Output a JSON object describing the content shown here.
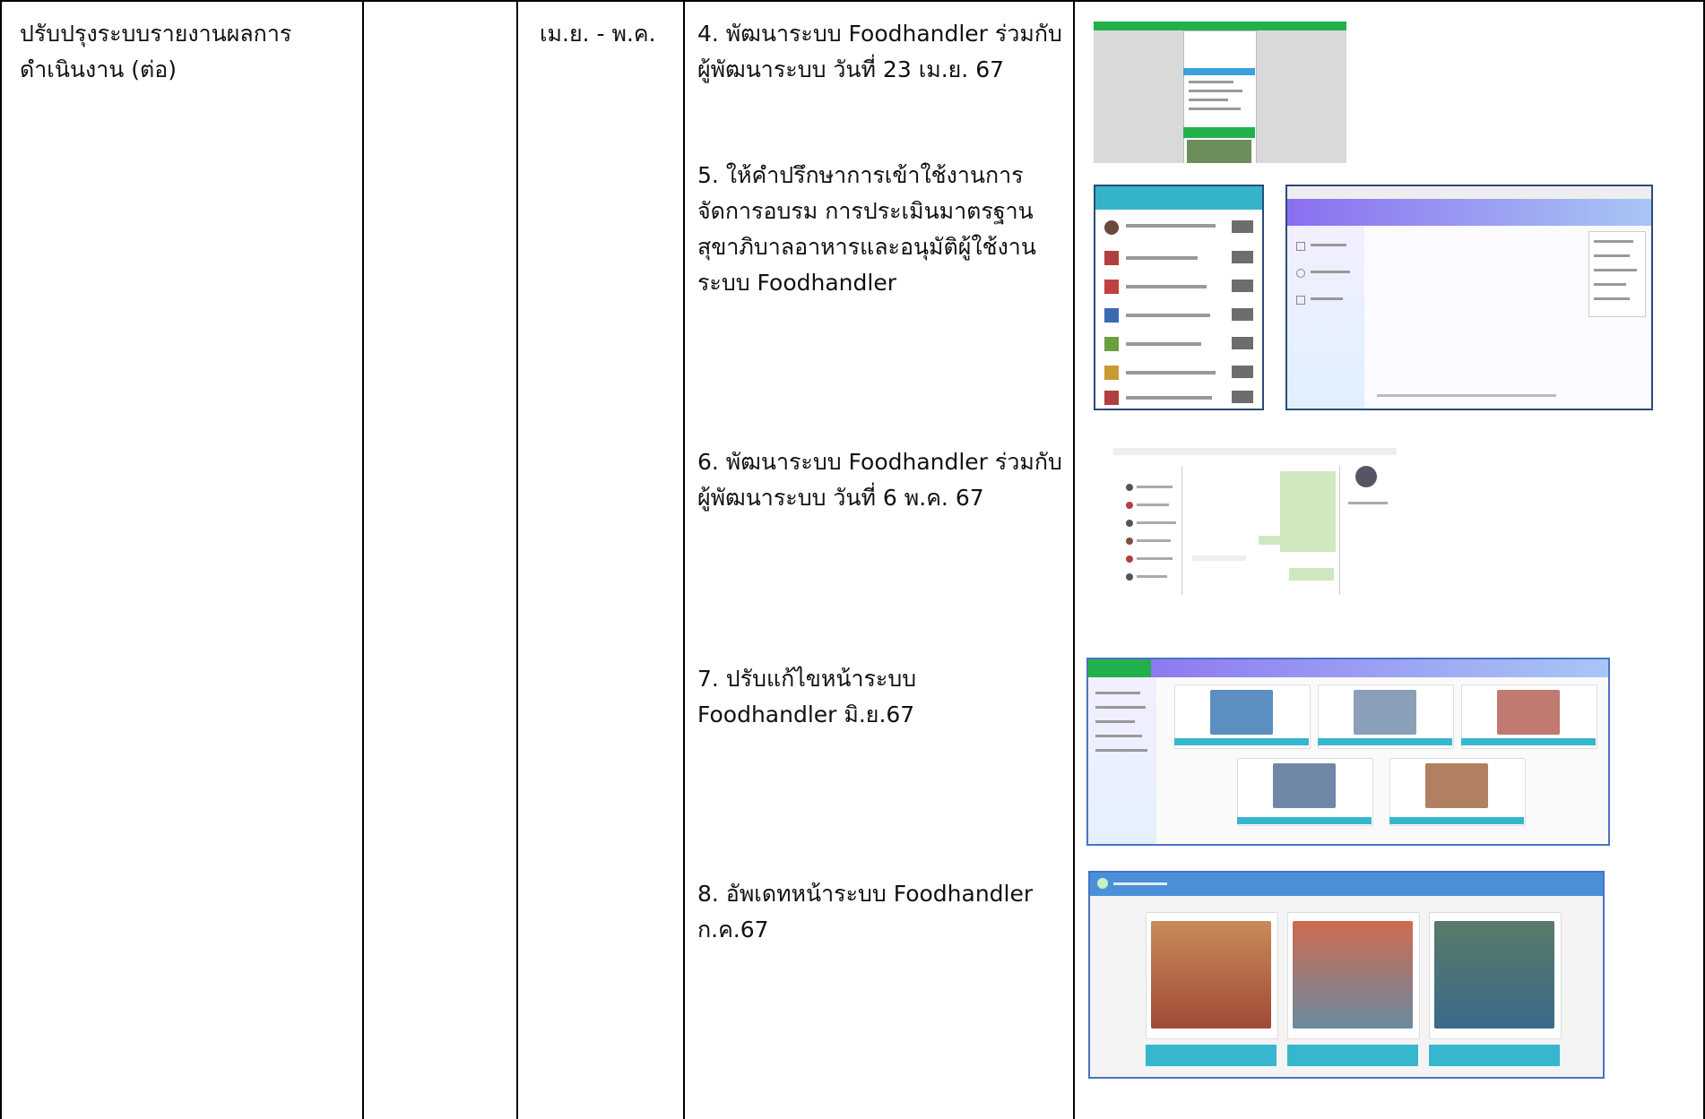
{
  "row": {
    "topic": "ปรับปรุงระบบรายงานผลการดำเนินงาน (ต่อ)",
    "period": "เม.ย. - พ.ค.",
    "activities": [
      "4. พัฒนาระบบ Foodhandler ร่วมกับผู้พัฒนาระบบ วันที่ 23 เม.ย. 67",
      "5. ให้คำปรึกษาการเข้าใช้งานการจัดการอบรม การประเมินมาตรฐานสุขาภิบาลอาหารและอนุมัติผู้ใช้งานระบบ Foodhandler",
      "6. พัฒนาระบบ Foodhandler ร่วมกับผู้พัฒนาระบบ วันที่ 6 พ.ค. 67",
      "7. ปรับแก้ไขหน้าระบบ Foodhandler มิ.ย.67",
      "8. อัพเดทหน้าระบบ Foodhandler ก.ค.67"
    ]
  },
  "colors": {
    "border": "#000000",
    "green_bar": "#22b04b",
    "purple_header": "#8a6ff0",
    "teal_button": "#37b6cf",
    "blue_header": "#4a90d9"
  }
}
